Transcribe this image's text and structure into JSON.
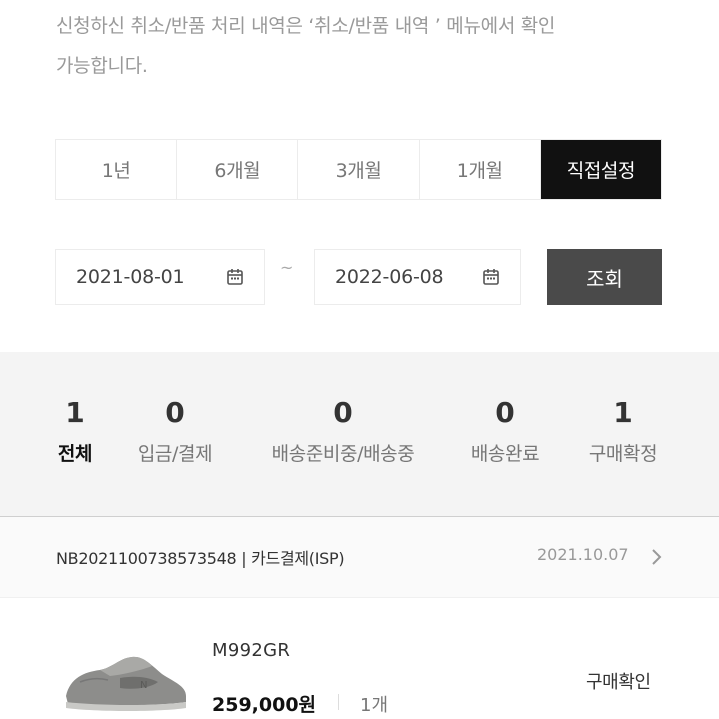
{
  "notice": {
    "line1": "신청하신 취소/반품 처리 내역은 ‘취소/반품 내역 ’ 메뉴에서 확인",
    "line2": "가능합니다."
  },
  "period_tabs": [
    {
      "label": "1년",
      "active": false
    },
    {
      "label": "6개월",
      "active": false
    },
    {
      "label": "3개월",
      "active": false
    },
    {
      "label": "1개월",
      "active": false
    },
    {
      "label": "직접설정",
      "active": true
    }
  ],
  "date_range": {
    "start": "2021-08-01",
    "separator": "~",
    "end": "2022-06-08",
    "search_label": "조회"
  },
  "stats": [
    {
      "count": "1",
      "label": "전체"
    },
    {
      "count": "0",
      "label": "입금/결제"
    },
    {
      "count": "0",
      "label": "배송준비중/배송중"
    },
    {
      "count": "0",
      "label": "배송완료"
    },
    {
      "count": "1",
      "label": "구매확정"
    }
  ],
  "order": {
    "number": "NB2021100738573548",
    "payment": "카드결제(ISP)",
    "date": "2021.10.07",
    "item": {
      "name": "M992GR",
      "price": "259,000원",
      "quantity": "1개",
      "status": "구매확인"
    }
  },
  "colors": {
    "active_tab": "#111111",
    "search_button": "#4a4a4a",
    "stats_background": "#f4f4f4",
    "notice_text": "#9a9a9a"
  },
  "icons": {
    "date_picker": "calendar-icon",
    "order_detail": "chevron-right-icon"
  }
}
